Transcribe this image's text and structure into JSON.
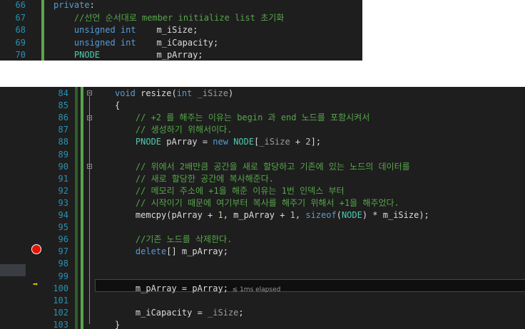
{
  "top_panel": {
    "lines": [
      {
        "num": "66",
        "segments": [
          {
            "t": "private",
            "c": "kw"
          },
          {
            "t": ":",
            "c": "id"
          }
        ]
      },
      {
        "num": "67",
        "segments": [
          {
            "t": "    //선언 순서대로 member initialize list 초기화",
            "c": "cm"
          }
        ]
      },
      {
        "num": "68",
        "segments": [
          {
            "t": "    unsigned int",
            "c": "kw"
          },
          {
            "t": "    m_iSize;",
            "c": "id"
          }
        ]
      },
      {
        "num": "69",
        "segments": [
          {
            "t": "    unsigned int",
            "c": "kw"
          },
          {
            "t": "    m_iCapacity;",
            "c": "id"
          }
        ]
      },
      {
        "num": "70",
        "segments": [
          {
            "t": "    PNODE",
            "c": "ty"
          },
          {
            "t": "           m_pArray;",
            "c": "id"
          }
        ]
      }
    ]
  },
  "main_panel": {
    "lines": [
      {
        "num": "84",
        "segments": [
          {
            "t": "void",
            "c": "kw"
          },
          {
            "t": " resize(",
            "c": "id"
          },
          {
            "t": "int",
            "c": "kw"
          },
          {
            "t": " _iSize",
            "c": "param"
          },
          {
            "t": ")",
            "c": "id"
          }
        ]
      },
      {
        "num": "85",
        "segments": [
          {
            "t": "{",
            "c": "id"
          }
        ]
      },
      {
        "num": "86",
        "segments": [
          {
            "t": "    // +2 를 해주는 이유는 begin 과 end 노드를 포함시켜서",
            "c": "cm"
          }
        ]
      },
      {
        "num": "87",
        "segments": [
          {
            "t": "    // 생성하기 위해서이다.",
            "c": "cm"
          }
        ]
      },
      {
        "num": "88",
        "segments": [
          {
            "t": "    PNODE",
            "c": "ty"
          },
          {
            "t": " pArray = ",
            "c": "id"
          },
          {
            "t": "new",
            "c": "kw"
          },
          {
            "t": " NODE",
            "c": "ty"
          },
          {
            "t": "[",
            "c": "id"
          },
          {
            "t": "_iSize",
            "c": "param"
          },
          {
            "t": " + ",
            "c": "id"
          },
          {
            "t": "2",
            "c": "num"
          },
          {
            "t": "];",
            "c": "id"
          }
        ]
      },
      {
        "num": "89",
        "segments": []
      },
      {
        "num": "90",
        "segments": [
          {
            "t": "    // 위에서 2배만큼 공간을 새로 할당하고 기존에 있는 노드의 데이터를",
            "c": "cm"
          }
        ]
      },
      {
        "num": "91",
        "segments": [
          {
            "t": "    // 새로 할당한 공간에 복사해준다.",
            "c": "cm"
          }
        ]
      },
      {
        "num": "92",
        "segments": [
          {
            "t": "    // 메모리 주소에 +1을 해준 이유는 1번 인덱스 부터",
            "c": "cm"
          }
        ]
      },
      {
        "num": "93",
        "segments": [
          {
            "t": "    // 시작이기 때문에 여기부터 복사를 해주기 위해서 +1을 해주었다.",
            "c": "cm"
          }
        ]
      },
      {
        "num": "94",
        "segments": [
          {
            "t": "    memcpy(pArray + ",
            "c": "id"
          },
          {
            "t": "1",
            "c": "num"
          },
          {
            "t": ", m_pArray + ",
            "c": "id"
          },
          {
            "t": "1",
            "c": "num"
          },
          {
            "t": ", ",
            "c": "id"
          },
          {
            "t": "sizeof",
            "c": "kw"
          },
          {
            "t": "(",
            "c": "id"
          },
          {
            "t": "NODE",
            "c": "ty"
          },
          {
            "t": ") * m_iSize);",
            "c": "id"
          }
        ]
      },
      {
        "num": "95",
        "segments": []
      },
      {
        "num": "96",
        "segments": [
          {
            "t": "    //기존 노드를 삭제한다.",
            "c": "cm"
          }
        ]
      },
      {
        "num": "97",
        "segments": [
          {
            "t": "    delete",
            "c": "kw"
          },
          {
            "t": "[] m_pArray;",
            "c": "id"
          }
        ]
      },
      {
        "num": "98",
        "segments": []
      },
      {
        "num": "99",
        "segments": []
      },
      {
        "num": "100",
        "segments": [
          {
            "t": "    m_pArray = pArray;",
            "c": "id"
          }
        ],
        "elapsed": "≤ 1ms elapsed"
      },
      {
        "num": "101",
        "segments": []
      },
      {
        "num": "102",
        "segments": [
          {
            "t": "    m_iCapacity = ",
            "c": "id"
          },
          {
            "t": "_iSize",
            "c": "param"
          },
          {
            "t": ";",
            "c": "id"
          }
        ]
      },
      {
        "num": "103",
        "segments": [
          {
            "t": "}",
            "c": "id"
          }
        ]
      }
    ],
    "breakpoint_line": "97",
    "current_line": "100",
    "colors": {
      "breakpoint": "#e51400",
      "current_arrow": "#ffcc00",
      "change_bar": "#57a64a",
      "current_line_bg": "#0f0f0f",
      "highlight_row_bg": "#3a3d41"
    }
  }
}
